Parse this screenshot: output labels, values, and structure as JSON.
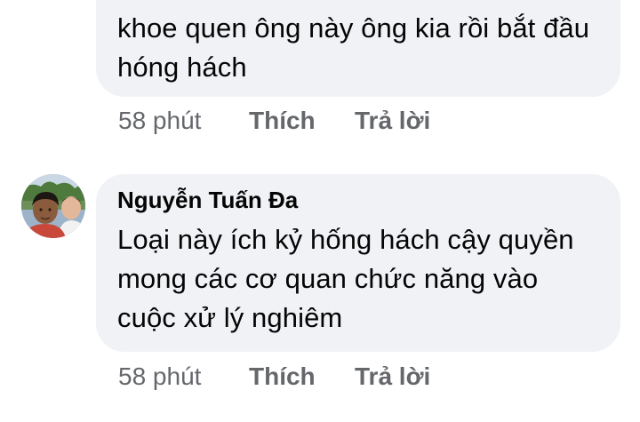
{
  "comments": [
    {
      "text": "khoe quen ông này ông kia rồi bắt đầu hóng hách",
      "time": "58 phút",
      "like_label": "Thích",
      "reply_label": "Trả lời"
    },
    {
      "author": "Nguyễn Tuấn Đa",
      "text": "Loại này ích kỷ hống hách cậy quyền mong các cơ quan chức năng vào cuộc xử lý nghiêm",
      "time": "58 phút",
      "like_label": "Thích",
      "reply_label": "Trả lời"
    }
  ],
  "colors": {
    "bubble_background": "#f0f2f5",
    "text": "#050505",
    "secondary_text": "#65676b"
  }
}
